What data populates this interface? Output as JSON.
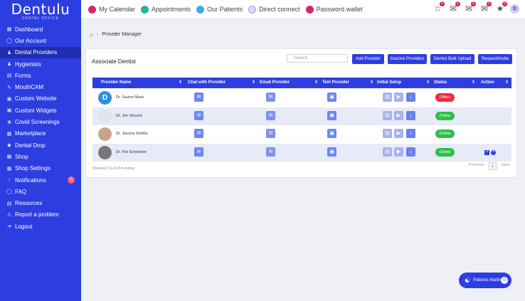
{
  "brand": {
    "name": "Dentulu",
    "tagline": "DENTAL OFFICE"
  },
  "sidebar": {
    "items": [
      {
        "label": "Dashboard",
        "icon": "dashboard-icon"
      },
      {
        "label": "Our Account",
        "icon": "account-icon"
      },
      {
        "label": "Dental Providers",
        "icon": "providers-icon"
      },
      {
        "label": "Hygienists",
        "icon": "hygienists-icon"
      },
      {
        "label": "Forms",
        "icon": "forms-icon"
      },
      {
        "label": "MouthCAM",
        "icon": "camera-icon"
      },
      {
        "label": "Custom Website",
        "icon": "website-icon"
      },
      {
        "label": "Custom Widgets",
        "icon": "widgets-icon"
      },
      {
        "label": "Covid Screenings",
        "icon": "virus-icon"
      },
      {
        "label": "Marketplace",
        "icon": "store-icon"
      },
      {
        "label": "Dental Drop",
        "icon": "drop-icon"
      },
      {
        "label": "Shop",
        "icon": "shop-icon"
      },
      {
        "label": "Shop Settings",
        "icon": "shop-settings-icon"
      },
      {
        "label": "Notifications",
        "icon": "bell-icon"
      },
      {
        "label": "FAQ",
        "icon": "faq-icon"
      },
      {
        "label": "Resources",
        "icon": "resources-icon"
      },
      {
        "label": "Report a problem",
        "icon": "warning-icon"
      },
      {
        "label": "Logout",
        "icon": "logout-icon"
      }
    ],
    "active_index": 2,
    "notifications_badge": "0"
  },
  "topbar": {
    "links": [
      {
        "label": "My Calendar",
        "color": "#d4246f"
      },
      {
        "label": "Appointments",
        "color": "#22b59a"
      },
      {
        "label": "Our Patients",
        "color": "#3fa9e8"
      },
      {
        "label": "Direct connect",
        "color": "#9aa0ee"
      },
      {
        "label": "Password wallet",
        "color": "#d4246f"
      }
    ],
    "icon_badges": [
      "0",
      "0",
      "0",
      "0",
      "0"
    ],
    "avatar_initial": "D"
  },
  "breadcrumb": {
    "page": "Provider Manager"
  },
  "card": {
    "title": "Associate Dentist",
    "search_placeholder": "Search",
    "buttons": [
      "Add Provider",
      "Inactive Providers",
      "Dentist Bulk Upload",
      "Request/Invite"
    ]
  },
  "table": {
    "columns": [
      "Provider Name",
      "Chat with Provider",
      "Email Provider",
      "Text Provider",
      "Initial Setup",
      "Status",
      "Action"
    ],
    "rows": [
      {
        "name": "Dr. Savion Mark",
        "avatar": "D",
        "status": "Offline"
      },
      {
        "name": "Dr. Jim Vincent",
        "avatar": "",
        "status": "Online"
      },
      {
        "name": "Dr. Jisoora Smiths",
        "avatar": "",
        "status": "Online"
      },
      {
        "name": "Dr. Pat Schneider",
        "avatar": "",
        "status": "Online"
      }
    ],
    "showing": "Showing 1 to 4 of 4 entries",
    "pager": {
      "prev": "Previous",
      "page": "1",
      "next": "Next"
    }
  },
  "colors": {
    "accent": "#2d3ee0",
    "online": "#2fbf4a",
    "offline": "#ee2a3e"
  },
  "waiting": {
    "label": "Patients Waiting",
    "count": "0"
  }
}
